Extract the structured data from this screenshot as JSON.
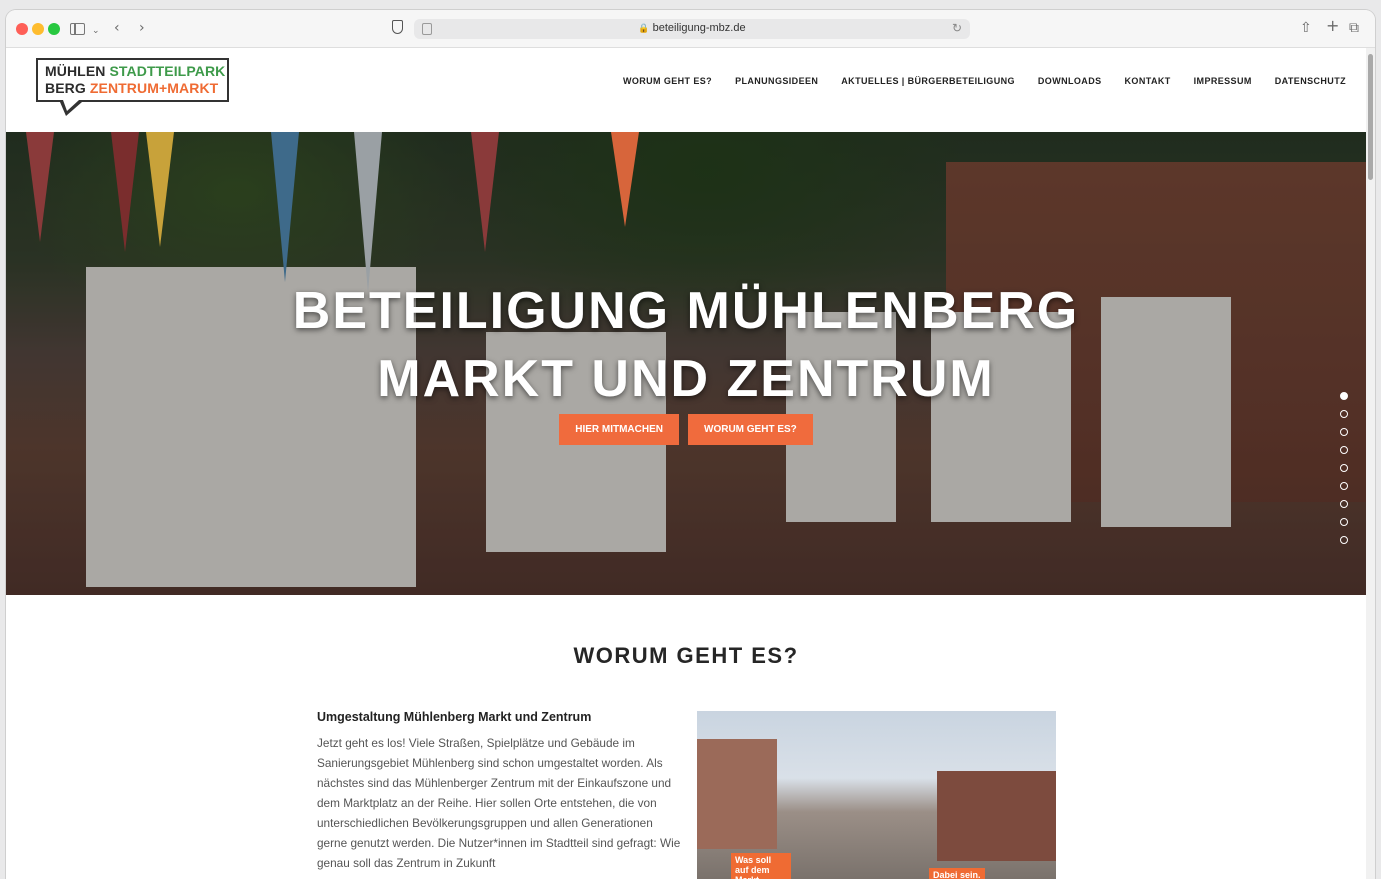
{
  "browser": {
    "url": "beteiligung-mbz.de"
  },
  "logo": {
    "line1_dark": "MÜHLEN",
    "line1_green": "STADTTEILPARK",
    "line2_dark": "BERG",
    "line2_orange": "ZENTRUM+MARKT"
  },
  "nav": [
    "WORUM GEHT ES?",
    "PLANUNGSIDEEN",
    "AKTUELLES | BÜRGERBETEILIGUNG",
    "DOWNLOADS",
    "KONTAKT",
    "IMPRESSUM",
    "DATENSCHUTZ"
  ],
  "hero": {
    "title_line1": "BETEILIGUNG MÜHLENBERG",
    "title_line2": "MARKT UND ZENTRUM",
    "button_primary": "HIER MITMACHEN",
    "button_secondary": "WORUM GEHT ES?",
    "slide_count": 9,
    "active_slide": 1
  },
  "section": {
    "title": "WORUM GEHT ES?",
    "article_heading": "Umgestaltung Mühlenberg Markt und Zentrum",
    "article_body": "Jetzt geht es los! Viele Straßen, Spielplätze und Gebäude im Sanierungsgebiet Mühlenberg sind schon umgestaltet worden. Als nächstes sind das Mühlenberger Zentrum mit der Einkaufszone und dem Marktplatz an der Reihe. Hier sollen Orte entstehen, die von unterschiedlichen Bevölkerungsgruppen und allen Generationen gerne genutzt werden. Die Nutzer*innen im Stadtteil sind gefragt: Wie genau soll das Zentrum in Zukunft",
    "photo_label_left": "Was soll auf dem Markt",
    "photo_label_right": "Dabei sein."
  },
  "colors": {
    "accent_orange": "#f06b3d",
    "logo_green": "#3e9a4a"
  }
}
